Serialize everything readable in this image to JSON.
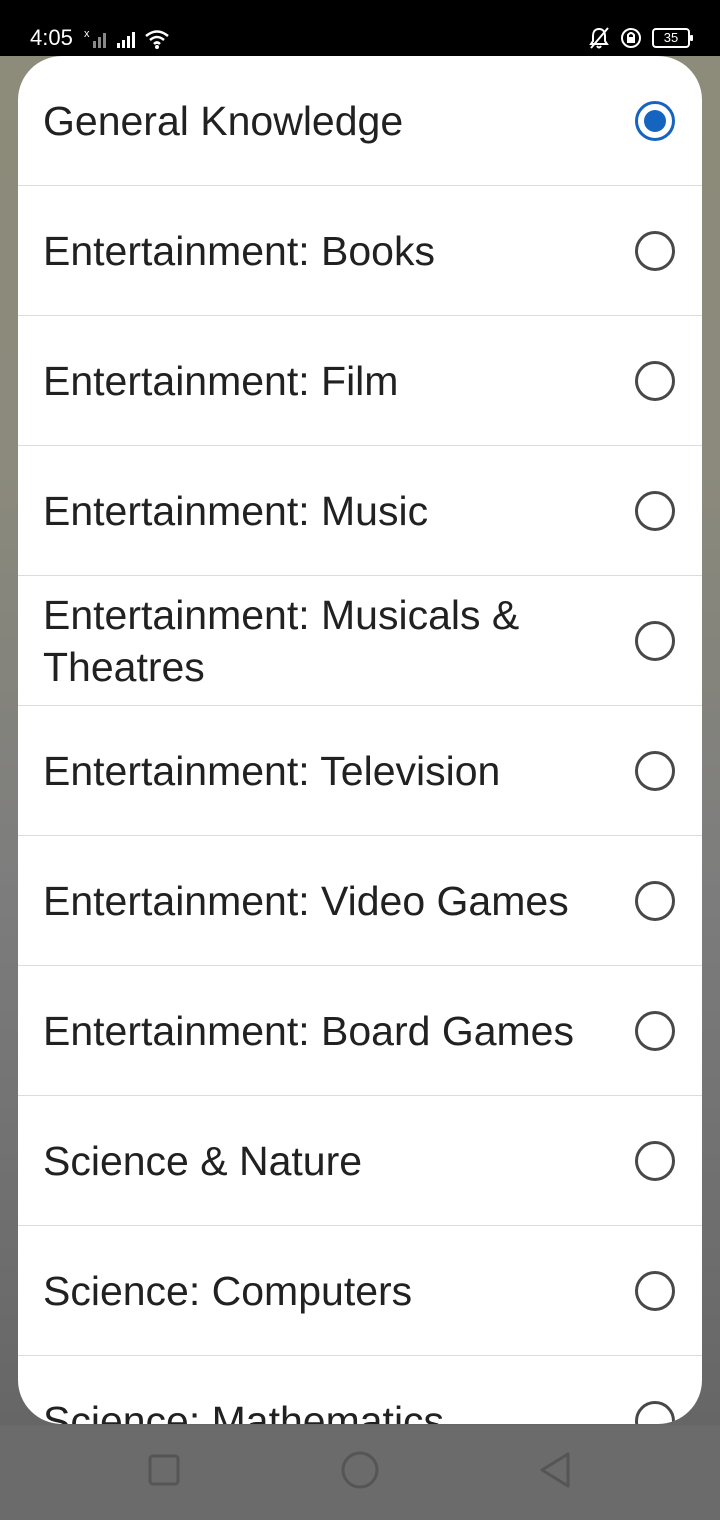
{
  "status_bar": {
    "time": "4:05",
    "battery_level": "35"
  },
  "dialog": {
    "selected_index": 0,
    "options": [
      {
        "label": "General Knowledge"
      },
      {
        "label": "Entertainment: Books"
      },
      {
        "label": "Entertainment: Film"
      },
      {
        "label": "Entertainment: Music"
      },
      {
        "label": "Entertainment: Musicals & Theatres"
      },
      {
        "label": "Entertainment: Television"
      },
      {
        "label": "Entertainment: Video Games"
      },
      {
        "label": "Entertainment: Board Games"
      },
      {
        "label": "Science & Nature"
      },
      {
        "label": "Science: Computers"
      },
      {
        "label": "Science: Mathematics"
      }
    ]
  },
  "colors": {
    "accent": "#1565c0",
    "radio_unchecked": "#484848"
  }
}
